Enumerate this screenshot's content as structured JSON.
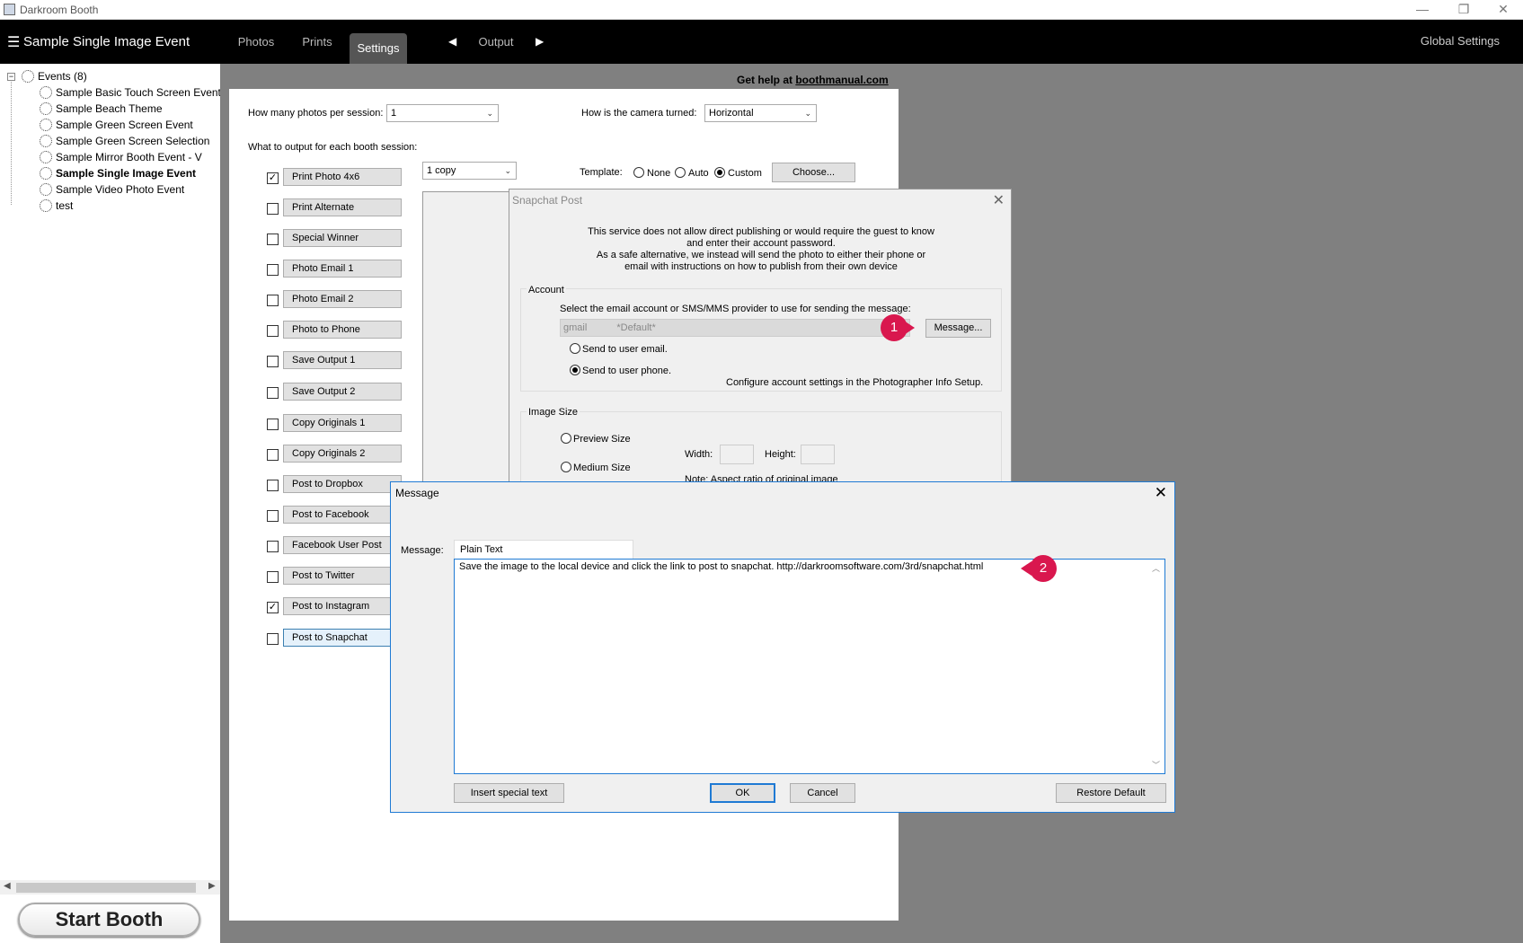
{
  "window": {
    "title": "Darkroom Booth",
    "minimize": "—",
    "restore": "❐",
    "close": "✕"
  },
  "nav": {
    "menu_icon": "☰",
    "event_title": "Sample Single Image Event",
    "tabs": [
      "Photos",
      "Prints",
      "Settings"
    ],
    "active_tab": "Settings",
    "prev_arrow": "◀",
    "next_arrow": "▶",
    "output_label": "Output",
    "global_settings": "Global Settings"
  },
  "tree": {
    "root": "Events (8)",
    "items": [
      "Sample Basic Touch Screen Event",
      "Sample Beach Theme",
      "Sample Green Screen Event",
      "Sample Green Screen Selection",
      "Sample Mirror Booth Event - V",
      "Sample Single Image Event",
      "Sample Video Photo Event",
      "test"
    ],
    "selected_index": 5
  },
  "start_booth": "Start Booth",
  "help": {
    "prefix": "Get help at ",
    "link": "boothmanual.com"
  },
  "settings": {
    "photos_per_session_label": "How many photos per session:",
    "photos_per_session_value": "1",
    "camera_turned_label": "How is the camera turned:",
    "camera_turned_value": "Horizontal",
    "output_label": "What to output for each booth session:",
    "copies_value": "1 copy",
    "template_label": "Template:",
    "template_options": [
      "None",
      "Auto",
      "Custom"
    ],
    "template_selected": "Custom",
    "choose_button": "Choose...",
    "outputs": [
      {
        "label": "Print Photo  4x6",
        "checked": true
      },
      {
        "label": "Print Alternate",
        "checked": false
      },
      {
        "label": "Special Winner",
        "checked": false
      },
      {
        "label": "Photo Email 1",
        "checked": false
      },
      {
        "label": "Photo Email 2",
        "checked": false
      },
      {
        "label": "Photo to Phone",
        "checked": false
      },
      {
        "label": "Save Output 1",
        "checked": false
      },
      {
        "label": "Save Output 2",
        "checked": false
      },
      {
        "label": "Copy Originals 1",
        "checked": false
      },
      {
        "label": "Copy Originals 2",
        "checked": false
      },
      {
        "label": "Post to Dropbox",
        "checked": false
      },
      {
        "label": "Post to Facebook",
        "checked": false
      },
      {
        "label": "Facebook User Post",
        "checked": false
      },
      {
        "label": "Post to Twitter",
        "checked": false
      },
      {
        "label": "Post to Instagram",
        "checked": true
      },
      {
        "label": "Post to Snapchat",
        "checked": false
      }
    ]
  },
  "snapchat_dialog": {
    "title": "Snapchat Post",
    "close": "✕",
    "intro_lines": [
      "This service does not allow direct publishing or would require the guest to know",
      "and enter their account password.",
      "As a safe alternative, we instead will send the photo to either their phone or",
      "email with instructions on how to publish from their own device"
    ],
    "account_group": "Account",
    "select_label": "Select the email account or SMS/MMS provider to use for sending the message:",
    "provider_value": "gmail",
    "provider_default": "*Default*",
    "message_button": "Message...",
    "send_email": "Send to user email.",
    "send_phone": "Send to user phone.",
    "send_selected": "phone",
    "configure_note": "Configure account settings in the Photographer Info Setup.",
    "image_size_group": "Image Size",
    "preview_size": "Preview Size",
    "medium_size": "Medium Size",
    "width_label": "Width:",
    "height_label": "Height:",
    "aspect_note": "Note: Aspect ratio of original image"
  },
  "message_dialog": {
    "title": "Message",
    "close": "✕",
    "message_label": "Message:",
    "format_tab": "Plain Text",
    "message_text": "Save the image to the local device and click the link to post to snapchat.   http://darkroomsoftware.com/3rd/snapchat.html",
    "insert_button": "Insert special text",
    "ok_button": "OK",
    "cancel_button": "Cancel",
    "restore_button": "Restore Default"
  },
  "markers": [
    "1",
    "2"
  ],
  "colors": {
    "nav_bg": "#000000",
    "workspace_bg": "#808080",
    "marker": "#d9174e",
    "focus_blue": "#1f7ad4"
  }
}
